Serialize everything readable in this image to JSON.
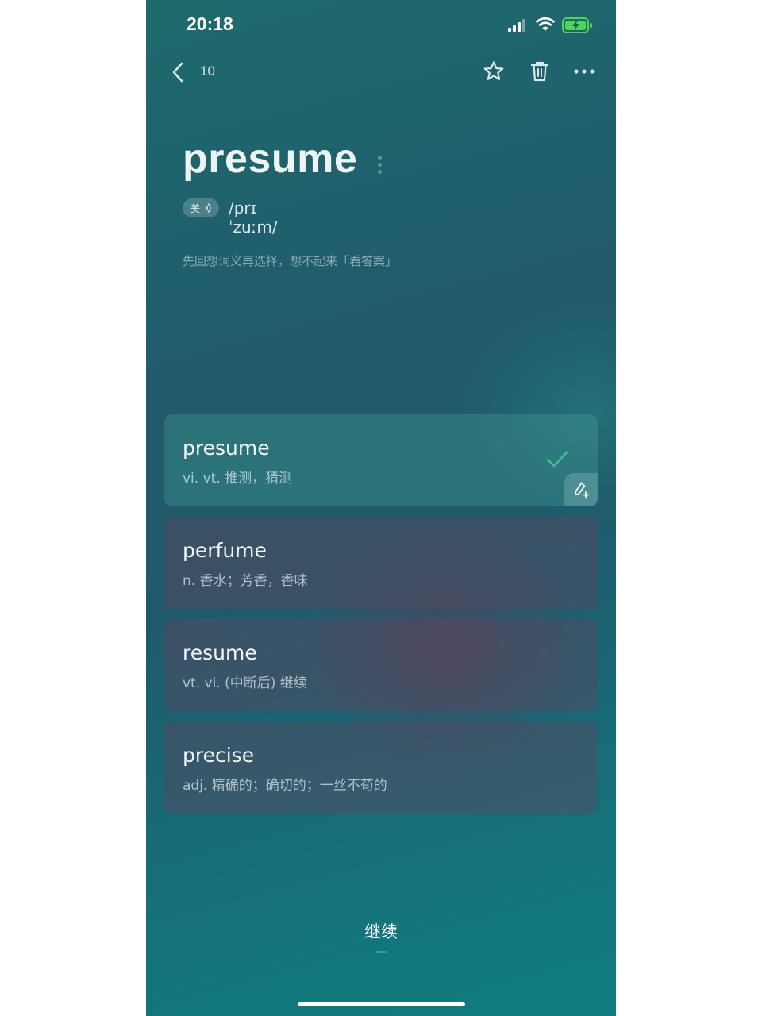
{
  "status_bar": {
    "time": "20:18"
  },
  "header": {
    "counter": "10"
  },
  "word": {
    "text": "presume",
    "accent_label": "美",
    "phonetic": "/prɪˈzuːm/",
    "hint": "先回想词义再选择，想不起来「看答案」"
  },
  "options": [
    {
      "word": "presume",
      "definition": "vi.  vt. 推测，猜测",
      "state": "correct"
    },
    {
      "word": "perfume",
      "definition": "n. 香水；芳香，香味",
      "state": "default"
    },
    {
      "word": "resume",
      "definition": "vt.  vi. (中断后) 继续",
      "state": "default"
    },
    {
      "word": "precise",
      "definition": "adj. 精确的；确切的；一丝不苟的",
      "state": "default"
    }
  ],
  "footer": {
    "continue_label": "继续"
  },
  "colors": {
    "accent_green": "#19a98a",
    "correct_check": "#3fc08a"
  }
}
